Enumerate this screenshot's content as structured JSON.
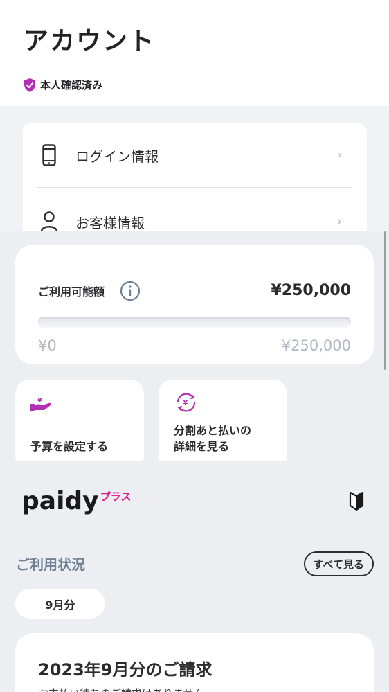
{
  "account": {
    "title": "アカウント",
    "verified_label": "本人確認済み",
    "rows": [
      {
        "label": "ログイン情報",
        "icon": "smartphone-icon"
      },
      {
        "label": "お客様情報",
        "icon": "person-icon"
      }
    ]
  },
  "credit": {
    "label": "ご利用可能額",
    "amount": "¥250,000",
    "range_min": "¥0",
    "range_max": "¥250,000",
    "used_fraction": 0
  },
  "actions": [
    {
      "label": "予算を設定する",
      "icon": "hand-coin-icon"
    },
    {
      "label_line1": "分割あと払いの",
      "label_line2": "詳細を見る",
      "icon": "yen-cycle-icon"
    }
  ],
  "brand": {
    "name": "paidy",
    "plus": "プラス"
  },
  "usage": {
    "title": "ご利用状況",
    "see_all": "すべて見る",
    "month": "9月分",
    "bill_title": "2023年9月分のご請求",
    "bill_sub": "お支払い待ちのご請求はありません"
  },
  "colors": {
    "accent": "#e0128c",
    "shield": "#b32fb4",
    "muted_title": "#6e8193"
  }
}
